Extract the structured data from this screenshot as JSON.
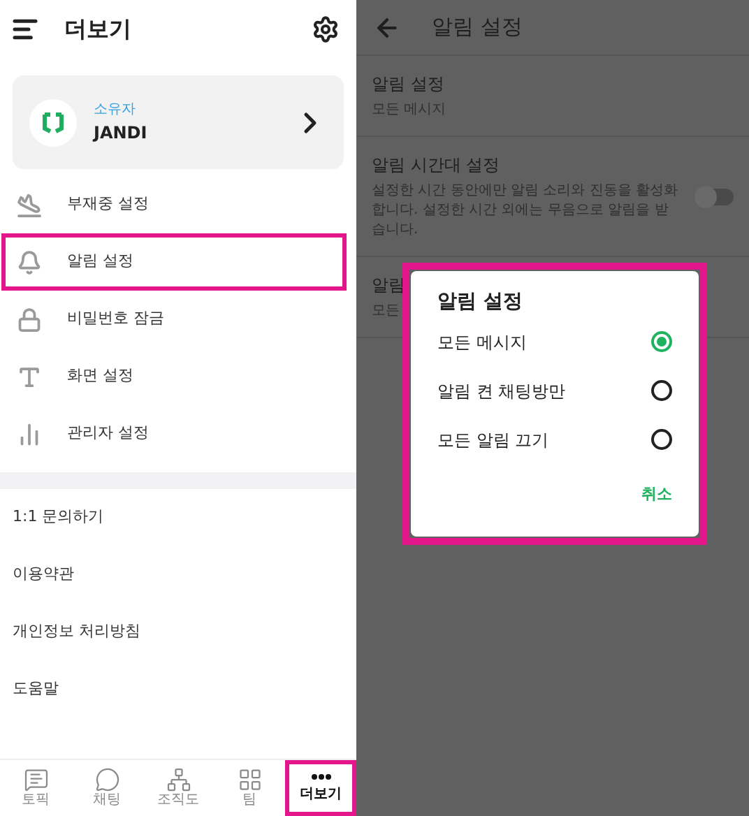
{
  "more_screen": {
    "title": "더보기",
    "profile": {
      "role": "소유자",
      "name": "JANDI"
    },
    "menu": [
      {
        "label": "부재중 설정",
        "highlighted": false
      },
      {
        "label": "알림 설정",
        "highlighted": true
      },
      {
        "label": "비밀번호 잠금",
        "highlighted": false
      },
      {
        "label": "화면 설정",
        "highlighted": false
      },
      {
        "label": "관리자 설정",
        "highlighted": false
      }
    ],
    "links": [
      "1:1 문의하기",
      "이용약관",
      "개인정보 처리방침",
      "도움말"
    ],
    "tabs": [
      {
        "label": "토픽",
        "selected": false,
        "highlighted": false
      },
      {
        "label": "채팅",
        "selected": false,
        "highlighted": false
      },
      {
        "label": "조직도",
        "selected": false,
        "highlighted": false
      },
      {
        "label": "팀",
        "selected": false,
        "highlighted": false
      },
      {
        "label": "더보기",
        "selected": true,
        "highlighted": true
      }
    ]
  },
  "notification_screen": {
    "title": "알림 설정",
    "rows": [
      {
        "title": "알림 설정",
        "subtitle": "모든 메시지"
      },
      {
        "title": "알림 시간대 설정",
        "subtitle": "설정한 시간 동안에만 알림 소리와 진동을 활성화 합니다. 설정한 시간 외에는 무음으로 알림을 받습니다.",
        "toggle": {
          "on": false
        }
      },
      {
        "title": "알림",
        "subtitle": "모든"
      }
    ],
    "dialog": {
      "title": "알림 설정",
      "options": [
        {
          "label": "모든 메시지",
          "selected": true
        },
        {
          "label": "알림 켠 채팅방만",
          "selected": false
        },
        {
          "label": "모든 알림 끄기",
          "selected": false
        }
      ],
      "cancel": "취소"
    }
  }
}
